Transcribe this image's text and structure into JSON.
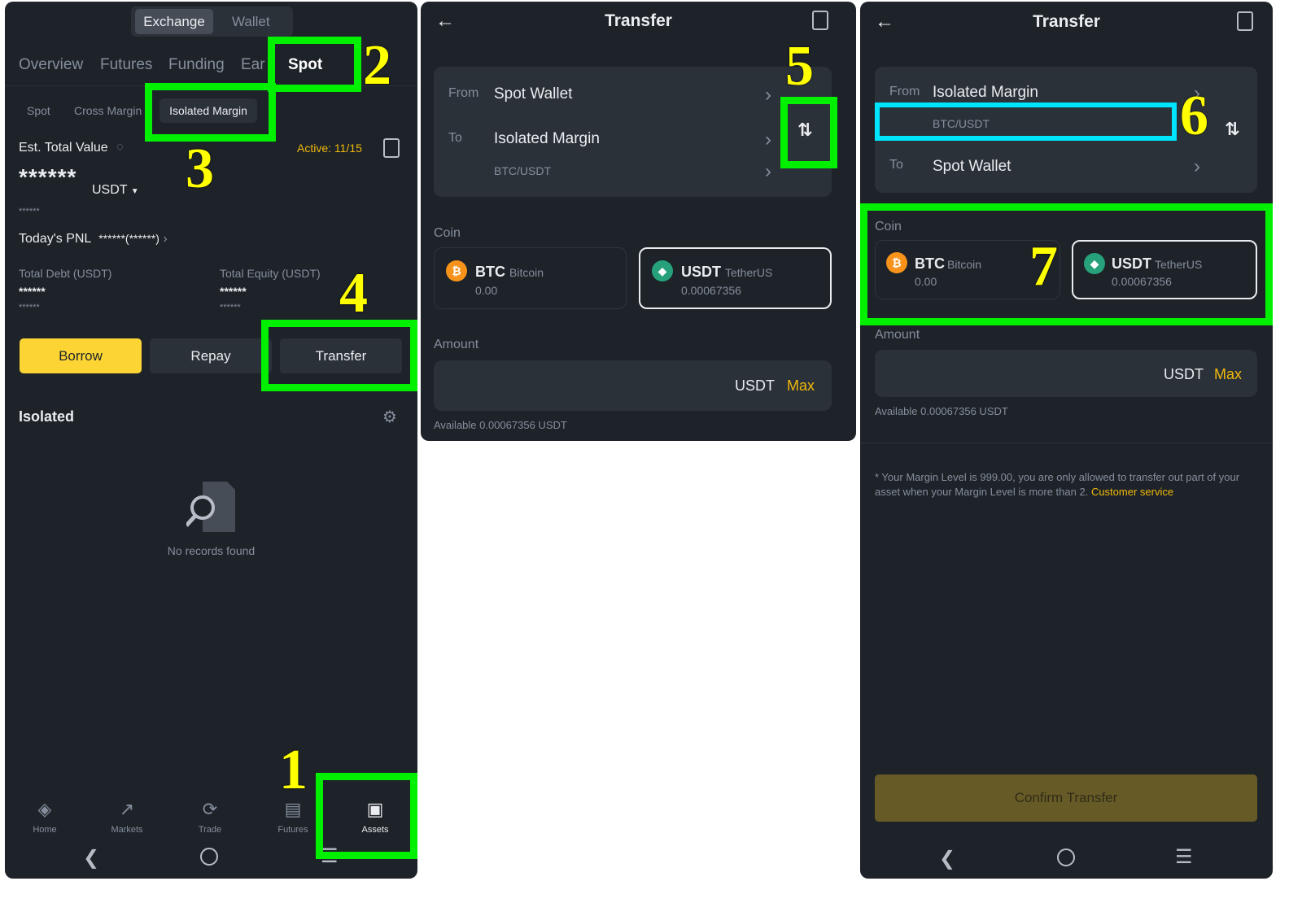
{
  "p1": {
    "segment": [
      "Exchange",
      "Wallet"
    ],
    "tabs": [
      "Overview",
      "Futures",
      "Funding",
      "Ear",
      "Spot"
    ],
    "subtabs": [
      "Spot",
      "Cross Margin",
      "Isolated Margin"
    ],
    "est_label": "Est. Total Value",
    "active": "Active: 11/15",
    "masked_value": "******",
    "currency": "USDT",
    "masked_small": "******",
    "pnl_label": "Today's PNL",
    "pnl_value": "******(******)",
    "debt_label": "Total Debt (USDT)",
    "equity_label": "Total Equity (USDT)",
    "debt_value": "******",
    "debt_sub": "******",
    "equity_value": "******",
    "equity_sub": "******",
    "borrow": "Borrow",
    "repay": "Repay",
    "transfer": "Transfer",
    "section": "Isolated",
    "empty": "No records found",
    "nav": [
      {
        "label": "Home",
        "icon": "home-icon"
      },
      {
        "label": "Markets",
        "icon": "markets-icon"
      },
      {
        "label": "Trade",
        "icon": "trade-icon"
      },
      {
        "label": "Futures",
        "icon": "futures-icon"
      },
      {
        "label": "Assets",
        "icon": "wallet-icon"
      }
    ]
  },
  "p2": {
    "title": "Transfer",
    "from_label": "From",
    "from_value": "Spot Wallet",
    "to_label": "To",
    "to_value": "Isolated Margin",
    "pair": "BTC/USDT",
    "coin_label": "Coin",
    "coins": [
      {
        "sym": "BTC",
        "name": "Bitcoin",
        "bal": "0.00"
      },
      {
        "sym": "USDT",
        "name": "TetherUS",
        "bal": "0.00067356"
      }
    ],
    "amount_label": "Amount",
    "unit": "USDT",
    "max": "Max",
    "available": "Available 0.00067356 USDT"
  },
  "p3": {
    "title": "Transfer",
    "from_label": "From",
    "from_value": "Isolated Margin",
    "pair": "BTC/USDT",
    "to_label": "To",
    "to_value": "Spot Wallet",
    "coin_label": "Coin",
    "coins": [
      {
        "sym": "BTC",
        "name": "Bitcoin",
        "bal": "0.00"
      },
      {
        "sym": "USDT",
        "name": "TetherUS",
        "bal": "0.00067356"
      }
    ],
    "amount_label": "Amount",
    "unit": "USDT",
    "max": "Max",
    "available": "Available 0.00067356 USDT",
    "note": "* Your Margin Level is 999.00, you are only allowed to transfer out part of your asset when your Margin Level is more than 2.",
    "note_link": "Customer service",
    "confirm": "Confirm Transfer"
  },
  "steps": [
    "1",
    "2",
    "3",
    "4",
    "5",
    "6",
    "7"
  ],
  "colors": {
    "bg": "#1e2329",
    "card": "#2b3139",
    "accent": "#f0b90b",
    "highlight": "#00f000",
    "highlight_cyan": "#00e5ff",
    "step_number": "#ffff00"
  }
}
